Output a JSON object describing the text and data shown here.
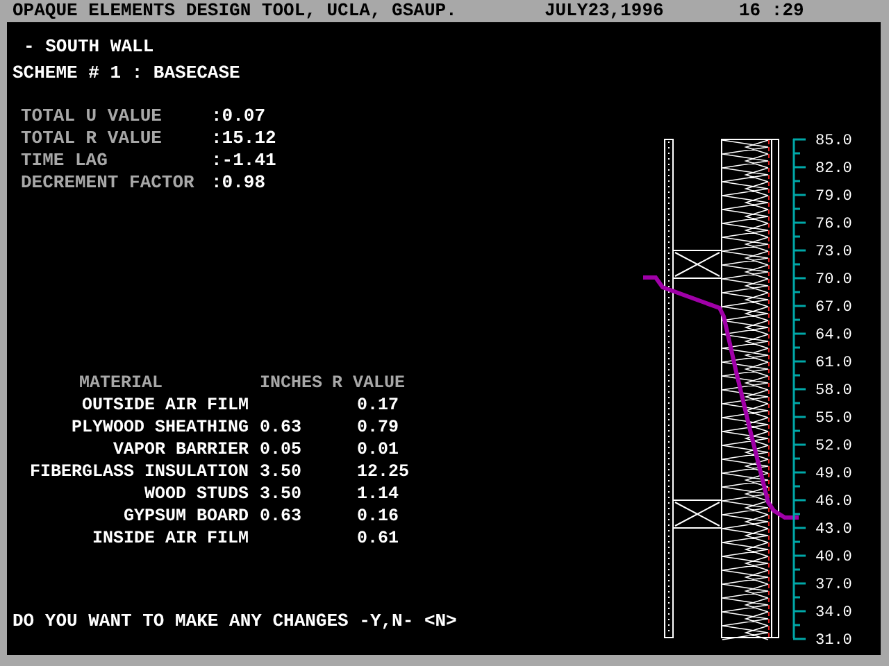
{
  "title_bar": {
    "title": "OPAQUE ELEMENTS DESIGN TOOL, UCLA, GSAUP.",
    "date": "JULY23,1996",
    "time": "16 :29"
  },
  "wall_name": "- SOUTH WALL",
  "scheme": "SCHEME # 1 : BASECASE",
  "totals": [
    {
      "label": "TOTAL U VALUE",
      "value": ":0.07"
    },
    {
      "label": "TOTAL R VALUE",
      "value": ":15.12"
    },
    {
      "label": "TIME LAG",
      "value": ":-1.41"
    },
    {
      "label": "DECREMENT FACTOR",
      "value": ":0.98"
    }
  ],
  "table": {
    "columns": [
      "MATERIAL",
      "INCHES",
      "R VALUE"
    ],
    "rows": [
      {
        "material": "OUTSIDE AIR FILM",
        "r_value": "0.17"
      },
      {
        "material": "PLYWOOD SHEATHING",
        "inches": "0.63",
        "r_value": "0.79"
      },
      {
        "material": "VAPOR BARRIER",
        "inches": "0.05",
        "r_value": "0.01"
      },
      {
        "material": "FIBERGLASS INSULATION",
        "inches": "3.50",
        "r_value": "12.25"
      },
      {
        "material": "WOOD STUDS",
        "inches": "3.50",
        "r_value": "1.14"
      },
      {
        "material": "GYPSUM BOARD",
        "inches": "0.63",
        "r_value": "0.16"
      },
      {
        "material": "INSIDE AIR FILM",
        "r_value": "0.61"
      }
    ]
  },
  "scale": {
    "labels": [
      "85.0",
      "82.0",
      "79.0",
      "76.0",
      "73.0",
      "70.0",
      "67.0",
      "64.0",
      "61.0",
      "58.0",
      "55.0",
      "52.0",
      "49.0",
      "46.0",
      "43.0",
      "40.0",
      "37.0",
      "34.0",
      "31.0"
    ]
  },
  "prompt": "DO YOU WANT TO MAKE ANY CHANGES -Y,N- <N>"
}
